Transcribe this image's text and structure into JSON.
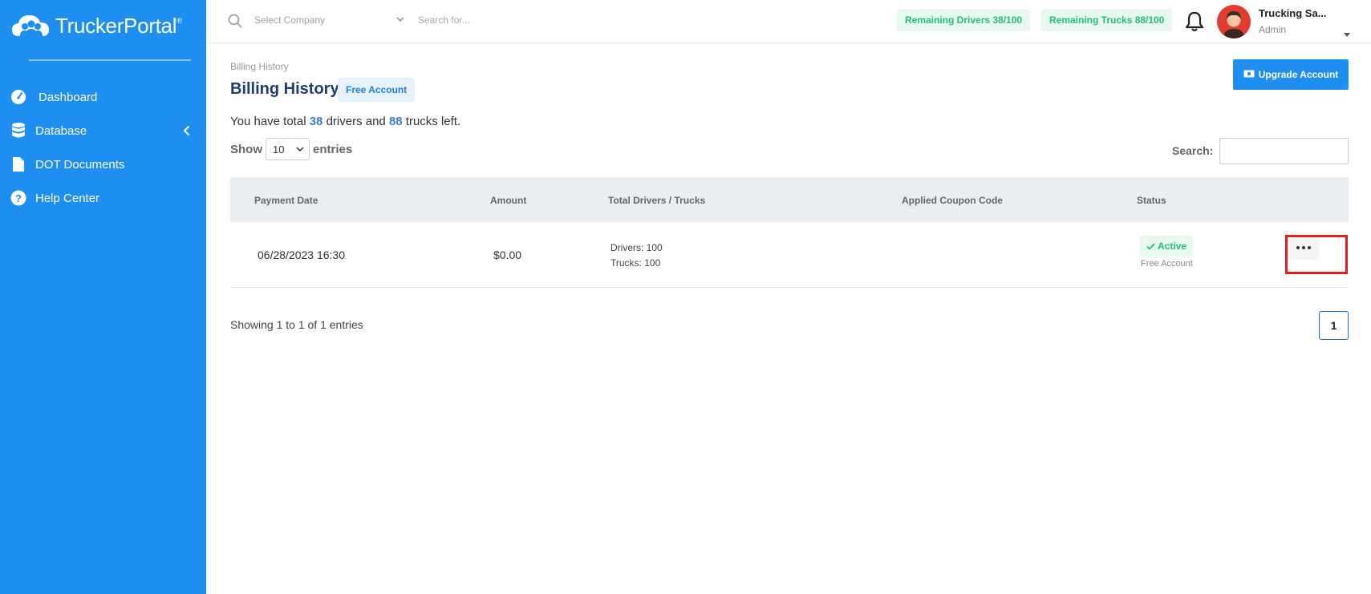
{
  "app": {
    "brand": "TruckerPortal",
    "brand_mark": "®"
  },
  "sidebar": {
    "items": [
      {
        "label": "Dashboard",
        "icon": "speedometer-icon"
      },
      {
        "label": "Database",
        "icon": "database-icon"
      },
      {
        "label": "DOT Documents",
        "icon": "document-icon"
      },
      {
        "label": "Help Center",
        "icon": "help-circle-icon"
      }
    ]
  },
  "topbar": {
    "company_placeholder": "Select Company",
    "search_placeholder": "Search for...",
    "remaining_drivers": "Remaining Drivers 38/100",
    "remaining_trucks": "Remaining Trucks 88/100",
    "user_name": "Trucking Sa...",
    "user_role": "Admin"
  },
  "page": {
    "breadcrumb": "Billing History",
    "title": "Billing History",
    "account_badge": "Free Account",
    "upgrade_label": "Upgrade Account",
    "summary_prefix": "You have total",
    "drivers_left": "38",
    "summary_mid": "drivers and",
    "trucks_left": "88",
    "summary_suffix": "trucks left."
  },
  "table_controls": {
    "show_label": "Show",
    "entries_value": "10",
    "entries_label": "entries",
    "search_label": "Search:"
  },
  "table": {
    "headers": [
      "Payment Date",
      "Amount",
      "Total Drivers / Trucks",
      "Applied Coupon Code",
      "Status"
    ],
    "rows": [
      {
        "payment_date": "06/28/2023 16:30",
        "amount": "$0.00",
        "drivers": "Drivers: 100",
        "trucks": "Trucks: 100",
        "coupon": "",
        "status": "Active",
        "status_sub": "Free Account"
      }
    ]
  },
  "footer": {
    "showing": "Showing 1 to 1 of 1 entries",
    "page": "1"
  },
  "colors": {
    "sidebar": "#1e8ff0",
    "accent_green": "#21c07a",
    "title_navy": "#1c3f6e",
    "highlight": "#e02020"
  }
}
